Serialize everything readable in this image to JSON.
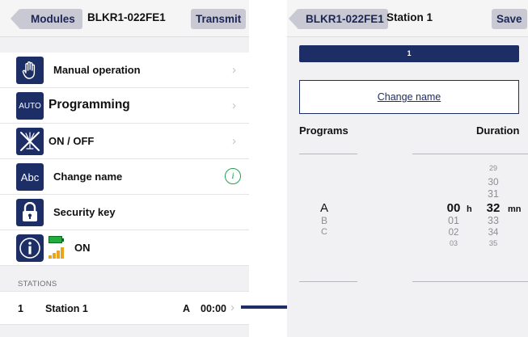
{
  "left": {
    "back_label": "Modules",
    "title": "BLKR1-022FE1",
    "action_label": "Transmit",
    "menu": [
      {
        "icon": "hand-icon",
        "label": "Manual operation"
      },
      {
        "icon": "auto-icon",
        "icon_text": "AUTO",
        "label": "Programming"
      },
      {
        "icon": "sprinkler-off-icon",
        "label": "ON / OFF"
      },
      {
        "icon": "abc-icon",
        "icon_text": "Abc",
        "label": "Change name"
      },
      {
        "icon": "lock-icon",
        "label": "Security key"
      },
      {
        "icon": "info-icon",
        "label": "ON"
      }
    ],
    "stations_header": "STATIONS",
    "station": {
      "number": "1",
      "name": "Station 1",
      "program": "A",
      "time": "00:00"
    }
  },
  "right": {
    "back_label": "BLKR1-022FE1",
    "title": "Station 1",
    "action_label": "Save",
    "progress_label": "1",
    "change_name_label": "Change name",
    "programs_header": "Programs",
    "duration_header": "Duration",
    "programs": {
      "selected": "A",
      "below": [
        "B",
        "C"
      ]
    },
    "hours": {
      "selected": "00",
      "below": [
        "01",
        "02",
        "03"
      ],
      "unit": "h"
    },
    "minutes": {
      "above": [
        "29",
        "30",
        "31"
      ],
      "selected": "32",
      "below": [
        "33",
        "34",
        "35"
      ],
      "unit": "mn"
    }
  },
  "colors": {
    "navy": "#1d2d66",
    "button_bg": "#c9c9d3",
    "green": "#22a050",
    "signal": "#e9a51f"
  }
}
